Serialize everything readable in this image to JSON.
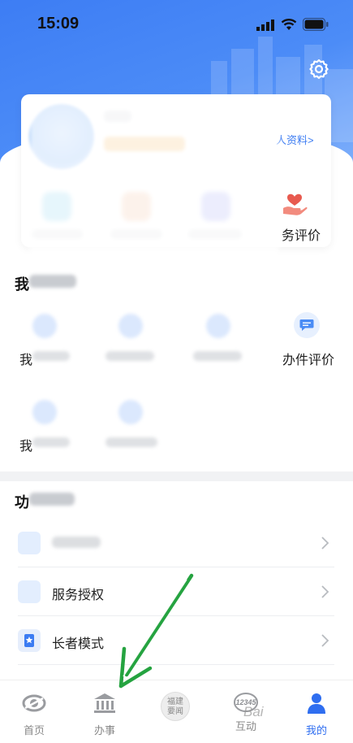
{
  "status_bar": {
    "time": "15:09"
  },
  "header": {
    "settings_icon": "gear-icon"
  },
  "profile_card": {
    "profile_link": "人资料>",
    "service_eval_label": "务评价"
  },
  "my_affairs": {
    "title": "我",
    "row1_left_char": "我",
    "row2_left_char": "我",
    "evaluate_label": "办件评价"
  },
  "functions": {
    "title": "功",
    "items": [
      {
        "label": "",
        "icon": "clock-icon"
      },
      {
        "label": "服务授权",
        "icon": "monitor-icon"
      },
      {
        "label": "长者模式",
        "icon": "elder-icon"
      }
    ]
  },
  "tabbar": {
    "tabs": [
      {
        "label": "首页",
        "icon": "home-logo-icon",
        "active": false
      },
      {
        "label": "办事",
        "icon": "building-icon",
        "active": false
      },
      {
        "label": "",
        "icon": "news-seal-icon",
        "badge_text": "福建要闻",
        "active": false
      },
      {
        "label": "互动",
        "icon": "hotline-icon",
        "badge_text": "12345",
        "active": false
      },
      {
        "label": "我的",
        "icon": "person-icon",
        "active": true
      }
    ]
  },
  "annotation": {
    "color": "#25a340"
  },
  "watermark": "Bai"
}
